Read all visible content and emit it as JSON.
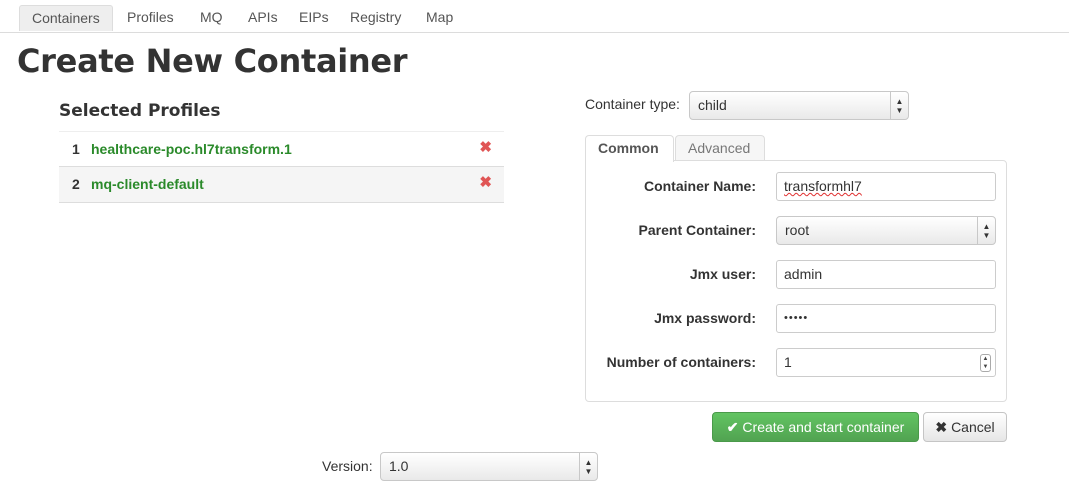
{
  "nav": {
    "items": [
      {
        "label": "Containers",
        "active": true
      },
      {
        "label": "Profiles",
        "active": false
      },
      {
        "label": "MQ",
        "active": false
      },
      {
        "label": "APIs",
        "active": false
      },
      {
        "label": "EIPs",
        "active": false
      },
      {
        "label": "Registry",
        "active": false
      },
      {
        "label": "Map",
        "active": false
      }
    ]
  },
  "page": {
    "title": "Create New Container"
  },
  "selected_profiles": {
    "title": "Selected Profiles",
    "rows": [
      {
        "number": "1",
        "name": "healthcare-poc.hl7transform.1",
        "remove_icon": "✖"
      },
      {
        "number": "2",
        "name": "mq-client-default",
        "remove_icon": "✖"
      }
    ]
  },
  "container_type": {
    "label": "Container type:",
    "value": "child"
  },
  "tabs": [
    {
      "label": "Common",
      "active": true
    },
    {
      "label": "Advanced",
      "active": false
    }
  ],
  "form": {
    "container_name": {
      "label": "Container Name:",
      "value": "transformhl7"
    },
    "parent_container": {
      "label": "Parent Container:",
      "value": "root"
    },
    "jmx_user": {
      "label": "Jmx user:",
      "value": "admin"
    },
    "jmx_password": {
      "label": "Jmx password:",
      "value": "•••••"
    },
    "number_of_containers": {
      "label": "Number of containers:",
      "value": "1"
    }
  },
  "actions": {
    "create_label": "Create and start container",
    "create_icon": "✔",
    "cancel_label": "Cancel",
    "cancel_icon": "✖"
  },
  "version": {
    "label": "Version:",
    "value": "1.0"
  },
  "colors": {
    "profile_link": "#2a8a2a",
    "remove_icon": "#e05555",
    "success_button": "#5bb75b"
  }
}
